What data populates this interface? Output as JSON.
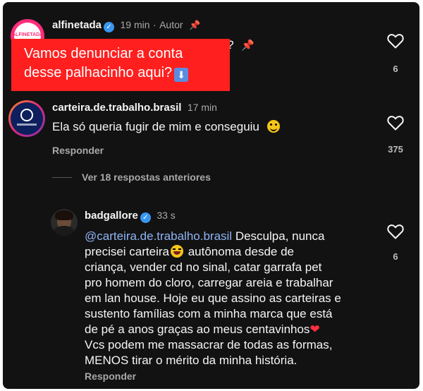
{
  "comments": [
    {
      "username": "alfinetada",
      "time": "19 min",
      "separator": "·",
      "role": "Autor",
      "pin_icon": "pin-icon",
      "partial_text_tail": "a ?",
      "likes": "6",
      "avatar_text": "ALFINETADA"
    },
    {
      "username": "carteira.de.trabalho.brasil",
      "time": "17 min",
      "text": "Ela só queria fugir de mim e conseguiu",
      "reply_label": "Responder",
      "likes": "375"
    },
    {
      "username": "badgallore",
      "time": "33 s",
      "mention": "@carteira.de.trabalho.brasil",
      "text_lines": [
        " Desculpa, nunca",
        "precisei carteira",
        " autônoma desde de",
        "criança, vender cd no sinal, catar garrafa pet",
        "pro homem do cloro, carregar areia e trabalhar",
        "em lan house. Hoje eu que assino as carteiras e",
        "sustento famílias com a minha marca que está",
        "de pé a anos graças ao meus centavinhos",
        "Vcs podem me massacrar de todas as formas,",
        "MENOS tirar o mérito da minha história."
      ],
      "reply_label": "Responder",
      "likes": "6"
    }
  ],
  "view_replies": "Ver 18 respostas anteriores",
  "banner": {
    "line1": "Vamos denunciar a conta",
    "line2": "desse palhacinho aqui?",
    "arrow": "⬇"
  },
  "colors": {
    "background": "#121212",
    "banner": "#ff1f1f",
    "mention": "#8fb4f5",
    "verified": "#3897f0"
  }
}
